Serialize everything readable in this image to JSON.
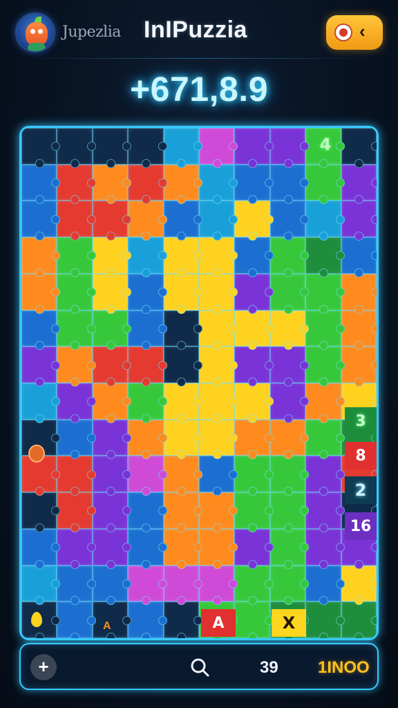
{
  "header": {
    "brand": "Jupezlia",
    "title": "InIPuzzia",
    "pill_icon": "chevron-left-icon"
  },
  "score": "+671,8.9",
  "board": {
    "rows": [
      [
        "dk",
        "dk",
        "dk",
        "dk",
        "cy",
        "mg",
        "pu",
        "pu",
        "gr",
        "dk"
      ],
      [
        "bl",
        "rd",
        "or",
        "rd",
        "or",
        "cy",
        "bl",
        "bl",
        "gr",
        "pu"
      ],
      [
        "bl",
        "rd",
        "rd",
        "or",
        "bl",
        "cy",
        "ye",
        "bl",
        "cy",
        "pu"
      ],
      [
        "or",
        "gr",
        "ye",
        "cy",
        "ye",
        "ye",
        "bl",
        "gr",
        "dg",
        "bl"
      ],
      [
        "or",
        "gr",
        "ye",
        "bl",
        "ye",
        "ye",
        "pu",
        "gr",
        "gr",
        "or"
      ],
      [
        "bl",
        "gr",
        "gr",
        "bl",
        "dk",
        "ye",
        "ye",
        "ye",
        "gr",
        "or"
      ],
      [
        "pu",
        "or",
        "rd",
        "rd",
        "dk",
        "ye",
        "pu",
        "pu",
        "gr",
        "or"
      ],
      [
        "cy",
        "pu",
        "or",
        "gr",
        "ye",
        "ye",
        "ye",
        "pu",
        "or",
        "ye"
      ],
      [
        "dk",
        "bl",
        "pu",
        "or",
        "ye",
        "ye",
        "or",
        "or",
        "gr",
        "dg"
      ],
      [
        "rd",
        "rd",
        "pu",
        "mg",
        "or",
        "bl",
        "gr",
        "gr",
        "pu",
        "rd"
      ],
      [
        "dk",
        "rd",
        "pu",
        "bl",
        "or",
        "or",
        "gr",
        "gr",
        "pu",
        "dk"
      ],
      [
        "bl",
        "pu",
        "pu",
        "bl",
        "or",
        "or",
        "pu",
        "gr",
        "pu",
        "pu"
      ],
      [
        "cy",
        "bl",
        "bl",
        "mg",
        "mg",
        "mg",
        "gr",
        "gr",
        "bl",
        "ye"
      ],
      [
        "dk",
        "bl",
        "dk",
        "bl",
        "dk",
        "gr",
        "gr",
        "dg",
        "dg",
        "dg"
      ]
    ],
    "tags": {
      "top": "4",
      "right_1": "3",
      "right_2": "8",
      "right_3": "2",
      "right_4": "16",
      "bottom_x": "X",
      "bottom_a": "A",
      "small_a": "A"
    }
  },
  "bottom_bar": {
    "count": "39",
    "coins": "1INOO"
  },
  "colors": {
    "accent": "#38c9ff",
    "coin": "#ffc21e",
    "pill": "#f09a13"
  }
}
